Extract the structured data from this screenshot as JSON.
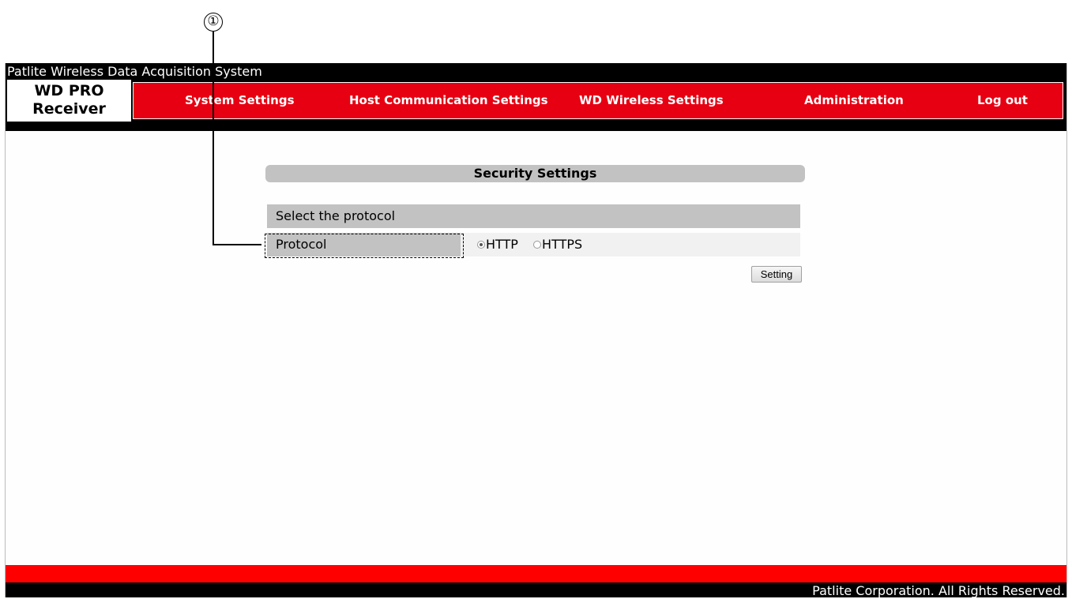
{
  "callout": {
    "number": "①"
  },
  "window": {
    "title": "Patlite Wireless Data Acquisition System"
  },
  "logo": {
    "line1": "WD PRO",
    "line2": "Receiver"
  },
  "nav": {
    "items": [
      {
        "label": "System Settings"
      },
      {
        "label": "Host Communication Settings"
      },
      {
        "label": "WD Wireless Settings"
      },
      {
        "label": "Administration"
      },
      {
        "label": "Log out"
      }
    ]
  },
  "main": {
    "section_title": "Security Settings",
    "group_header": "Select the protocol",
    "protocol": {
      "label": "Protocol",
      "options": [
        {
          "label": "HTTP",
          "checked": true
        },
        {
          "label": "HTTPS",
          "checked": false
        }
      ]
    },
    "setting_button": "Setting"
  },
  "footer": {
    "copyright": "Patlite Corporation. All Rights Reserved."
  },
  "colors": {
    "accent_red": "#e60012",
    "bar_black": "#000000",
    "panel_gray": "#c2c2c2"
  }
}
